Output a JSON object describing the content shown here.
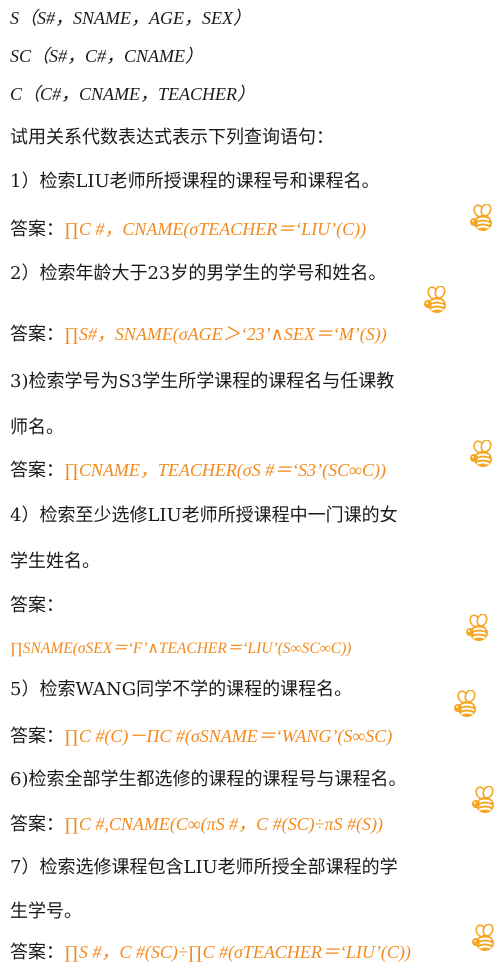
{
  "schema": {
    "s": "S（S#，SNAME，AGE，SEX）",
    "sc": "SC（S#，C#，CNAME）",
    "c": "C（C#，CNAME，TEACHER）"
  },
  "instruction": "试用关系代数表达式表示下列查询语句：",
  "answer_label": "答案：",
  "q1": {
    "text": "1）检索LIU老师所授课程的课程号和课程名。",
    "answer": "∏C #，CNAME(σTEACHER＝‘LIU’(C))"
  },
  "q2": {
    "text": "2）检索年龄大于23岁的男学生的学号和姓名。",
    "answer": "∏S#，SNAME(σAGE＞‘23’∧SEX＝‘M’(S))"
  },
  "q3": {
    "text_line1": "3)检索学号为S3学生所学课程的课程名与任课教",
    "text_line2": "师名。",
    "answer": "∏CNAME，TEACHER(σS #＝‘S3’(SC∞C))"
  },
  "q4": {
    "text_line1": "4）检索至少选修LIU老师所授课程中一门课的女",
    "text_line2": "学生姓名。",
    "answer": "∏SNAME(σSEX＝‘F’∧TEACHER＝‘LIU’(S∞SC∞C))"
  },
  "q5": {
    "text": "5）检索WANG同学不学的课程的课程名。",
    "answer": "∏C #(C)－ΠC #(σSNAME＝‘WANG’(S∞SC)"
  },
  "q6": {
    "text": "6)检索全部学生都选修的课程的课程号与课程名。",
    "answer": "∏C #,CNAME(C∞(πS #，C #(SC)÷πS #(S))"
  },
  "q7": {
    "text_line1": "7）检索选修课程包含LIU老师所授全部课程的学",
    "text_line2": "生学号。",
    "answer": "∏S #，C #(SC)÷∏C #(σTEACHER＝‘LIU’(C))"
  },
  "colors": {
    "answer": "#f28a1c",
    "text": "#1a1a1a",
    "bee_body": "#f5a623"
  },
  "icons": [
    "bee-icon"
  ]
}
